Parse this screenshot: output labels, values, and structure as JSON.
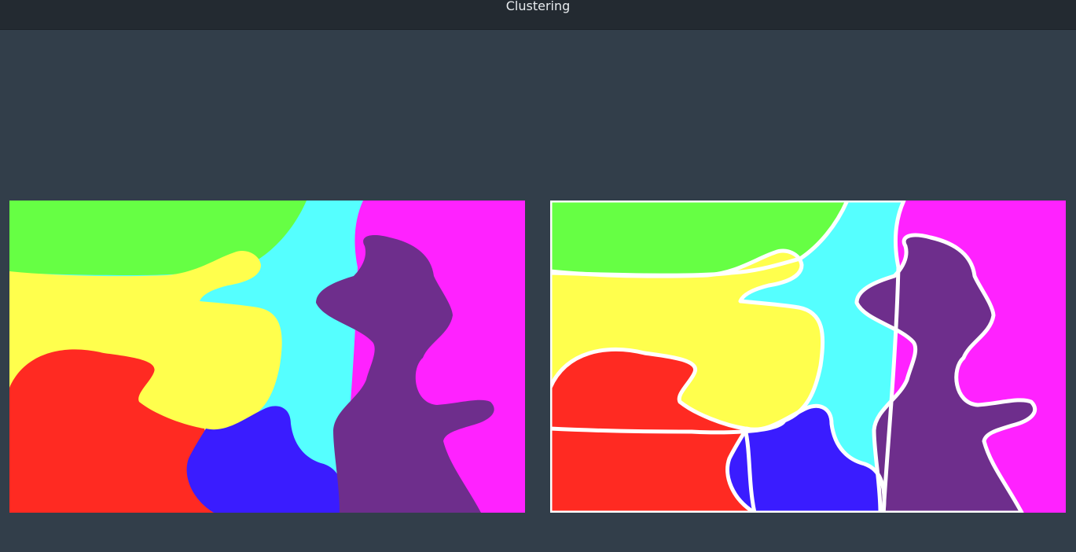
{
  "window": {
    "title": "Clustering"
  },
  "panels": [
    {
      "name": "original-clusters",
      "outlined": false
    },
    {
      "name": "outlined-clusters",
      "outlined": true
    }
  ],
  "region_colors": {
    "green": "#66ff44",
    "cyan": "#55ffff",
    "magenta": "#ff22ff",
    "yellow": "#ffff4d",
    "red": "#ff2a22",
    "blue": "#3a1cff",
    "purple": "#6e2e8c",
    "outline": "#ffffff"
  }
}
